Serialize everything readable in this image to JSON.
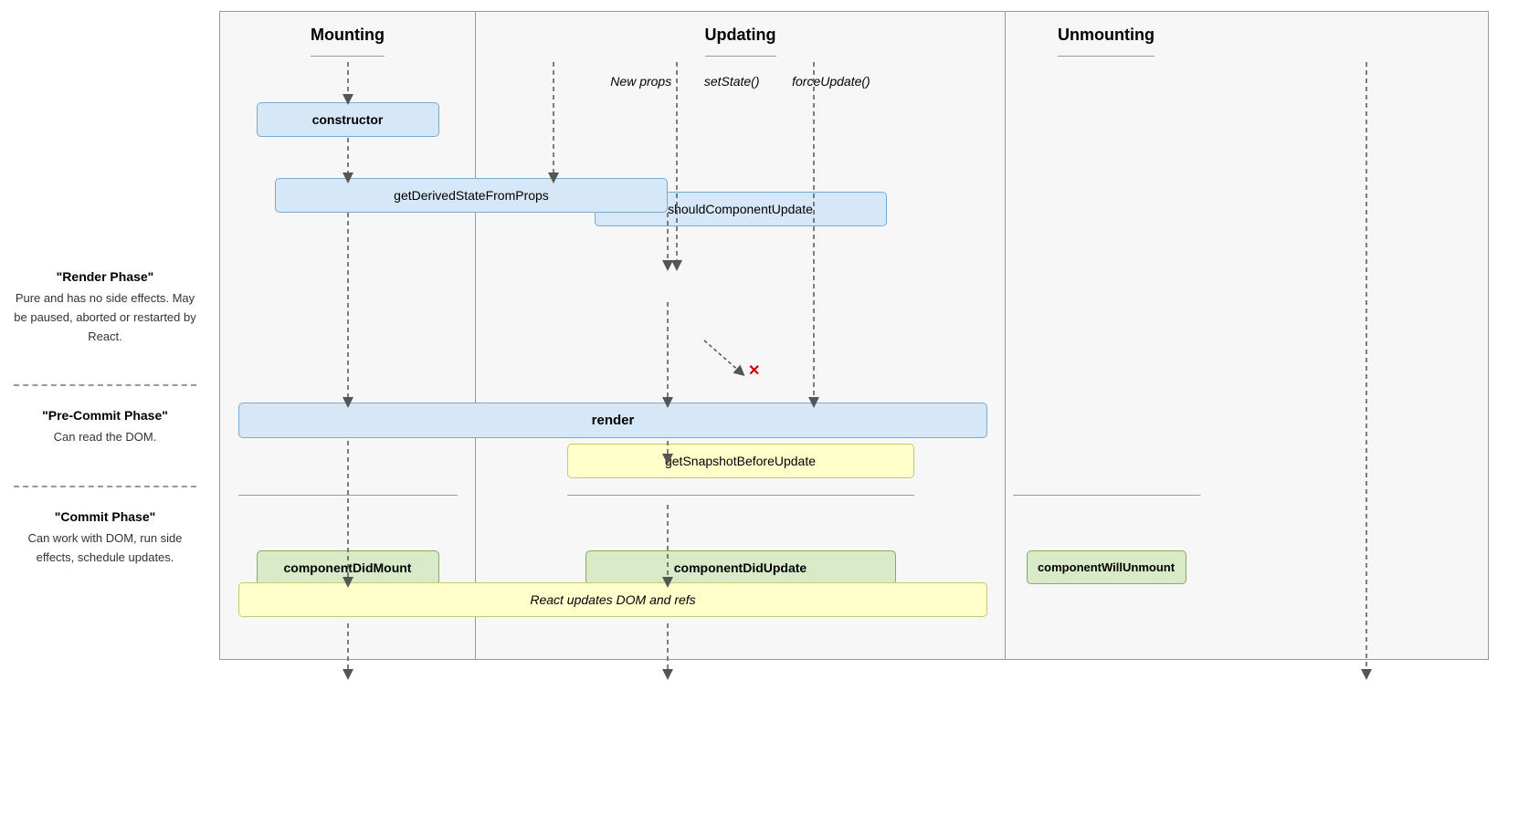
{
  "sidebar": {
    "render_phase_title": "\"Render Phase\"",
    "render_phase_desc": "Pure and has no side effects.\nMay be paused, aborted or\nrestarted by React.",
    "pre_commit_title": "\"Pre-Commit Phase\"",
    "pre_commit_desc": "Can read the DOM.",
    "commit_title": "\"Commit Phase\"",
    "commit_desc": "Can work with DOM,\nrun side effects,\nschedule updates."
  },
  "columns": {
    "mounting": "Mounting",
    "updating": "Updating",
    "unmounting": "Unmounting"
  },
  "updating_triggers": {
    "new_props": "New props",
    "set_state": "setState()",
    "force_update": "forceUpdate()"
  },
  "methods": {
    "constructor": "constructor",
    "get_derived_state": "getDerivedStateFromProps",
    "should_component_update": "shouldComponentUpdate",
    "render": "render",
    "get_snapshot": "getSnapshotBeforeUpdate",
    "react_updates_dom": "React updates DOM and refs",
    "component_did_mount": "componentDidMount",
    "component_did_update": "componentDidUpdate",
    "component_will_unmount": "componentWillUnmount"
  },
  "colors": {
    "blue_bg": "#d6e8f7",
    "blue_border": "#7aaad0",
    "yellow_bg": "#ffffcc",
    "yellow_border": "#c8c870",
    "green_bg": "#d8eac8",
    "green_border": "#88aa66",
    "col_bg": "#f7f7f7",
    "col_border": "#999",
    "red": "#cc0000"
  }
}
